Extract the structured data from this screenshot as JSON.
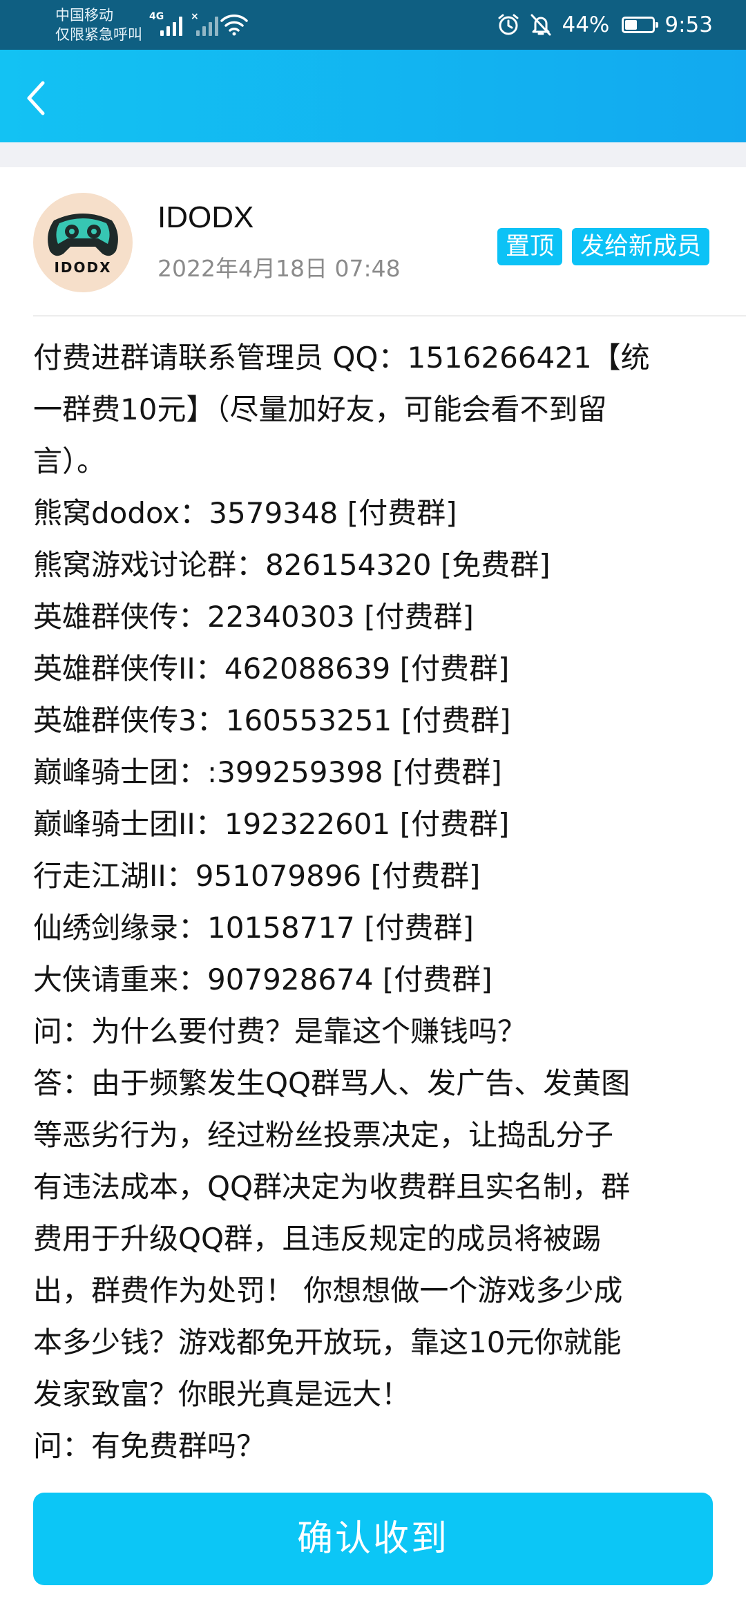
{
  "status_bar": {
    "carrier_line1": "中国移动",
    "carrier_line2": "仅限紧急呼叫",
    "network_label": "4G",
    "no_service_mark": "×",
    "battery_percent": "44%",
    "battery_level": 0.44,
    "time": "9:53",
    "icons": [
      "signal-icon",
      "signal-off-icon",
      "wifi-icon",
      "alarm-icon",
      "mute-bell-icon",
      "battery-icon"
    ]
  },
  "nav": {
    "back_icon": "chevron-left-icon",
    "color": "#13bdf2"
  },
  "notice": {
    "group_name": "IDODX",
    "avatar_text": "IDODX",
    "date": "2022年4月18日 07:48",
    "pin_label": "置顶",
    "send_new_label": "发给新成员",
    "accent_color": "#0cc2f6"
  },
  "content_lines": [
    "付费进群请联系管理员 QQ：1516266421【统",
    "一群费10元】（尽量加好友，可能会看不到留",
    "言）。",
    "熊窝dodox：3579348 [付费群]",
    "熊窝游戏讨论群：826154320 [免费群]",
    "英雄群侠传：22340303 [付费群]",
    "英雄群侠传II：462088639 [付费群]",
    "英雄群侠传3：160553251 [付费群]",
    "巅峰骑士团：:399259398 [付费群]",
    "巅峰骑士团II：192322601 [付费群]",
    "行走江湖II：951079896 [付费群]",
    "仙绣剑缘录：10158717 [付费群]",
    "大侠请重来：907928674 [付费群]",
    "问：为什么要付费？是靠这个赚钱吗？",
    "答：由于频繁发生QQ群骂人、发广告、发黄图",
    "等恶劣行为，经过粉丝投票决定，让捣乱分子",
    "有违法成本，QQ群决定为收费群且实名制，群",
    "费用于升级QQ群，且违反规定的成员将被踢",
    "出，群费作为处罚！ 你想想做一个游戏多少成",
    "本多少钱？游戏都免开放玩，靠这10元你就能",
    "发家致富？你眼光真是远大！",
    "问：有免费群吗？"
  ],
  "confirm": {
    "label": "确认收到"
  }
}
